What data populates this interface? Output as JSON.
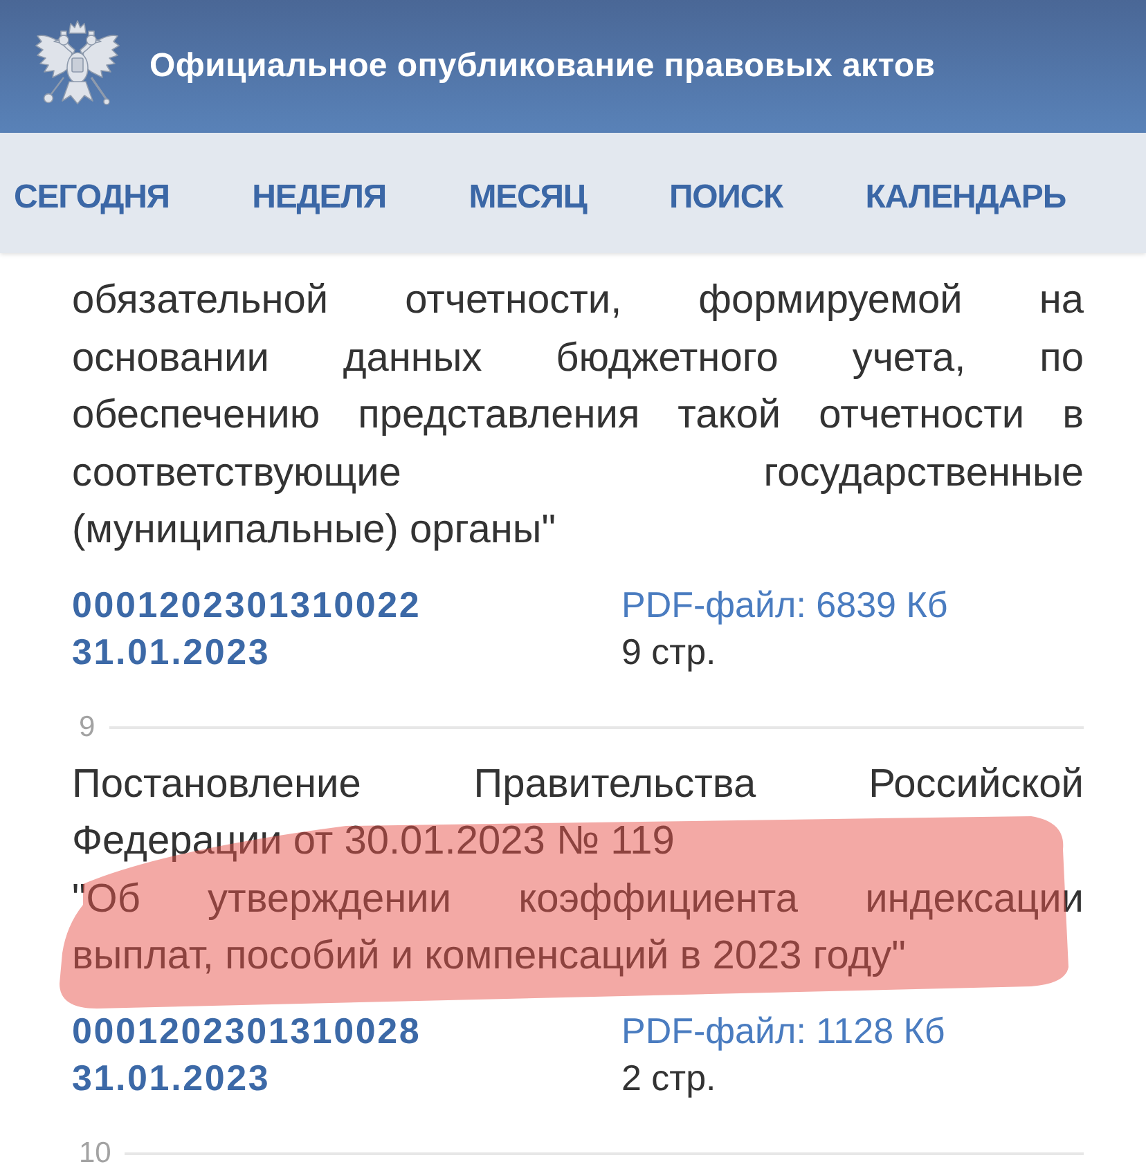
{
  "header": {
    "title": "Официальное опубликование правовых актов"
  },
  "nav_tabs": [
    "СЕГОДНЯ",
    "НЕДЕЛЯ",
    "МЕСЯЦ",
    "ПОИСК",
    "КАЛЕНДАРЬ"
  ],
  "documents": [
    {
      "paragraphs": [
        [
          "обязательной отчетности, формируемой на",
          "основании данных бюджетного учета, по",
          "обеспечению представления такой отчетности в",
          "соответствующие государственные",
          "(муниципальные) органы\""
        ]
      ],
      "number": "0001202301310022",
      "date": "31.01.2023",
      "file": "PDF-файл: 6839 Кб",
      "pages": "9 стр.",
      "highlighted": false
    },
    {
      "index": "9",
      "paragraphs": [
        [
          "Постановление Правительства Российской",
          "Федерации от 30.01.2023 № 119"
        ],
        [
          "\"Об утверждении коэффициента индексации",
          "выплат, пособий и компенсаций в 2023 году\""
        ]
      ],
      "number": "0001202301310028",
      "date": "31.01.2023",
      "file": "PDF-файл: 1128 Кб",
      "pages": "2 стр.",
      "highlighted": true
    },
    {
      "index": "10",
      "highlighted": false
    }
  ]
}
